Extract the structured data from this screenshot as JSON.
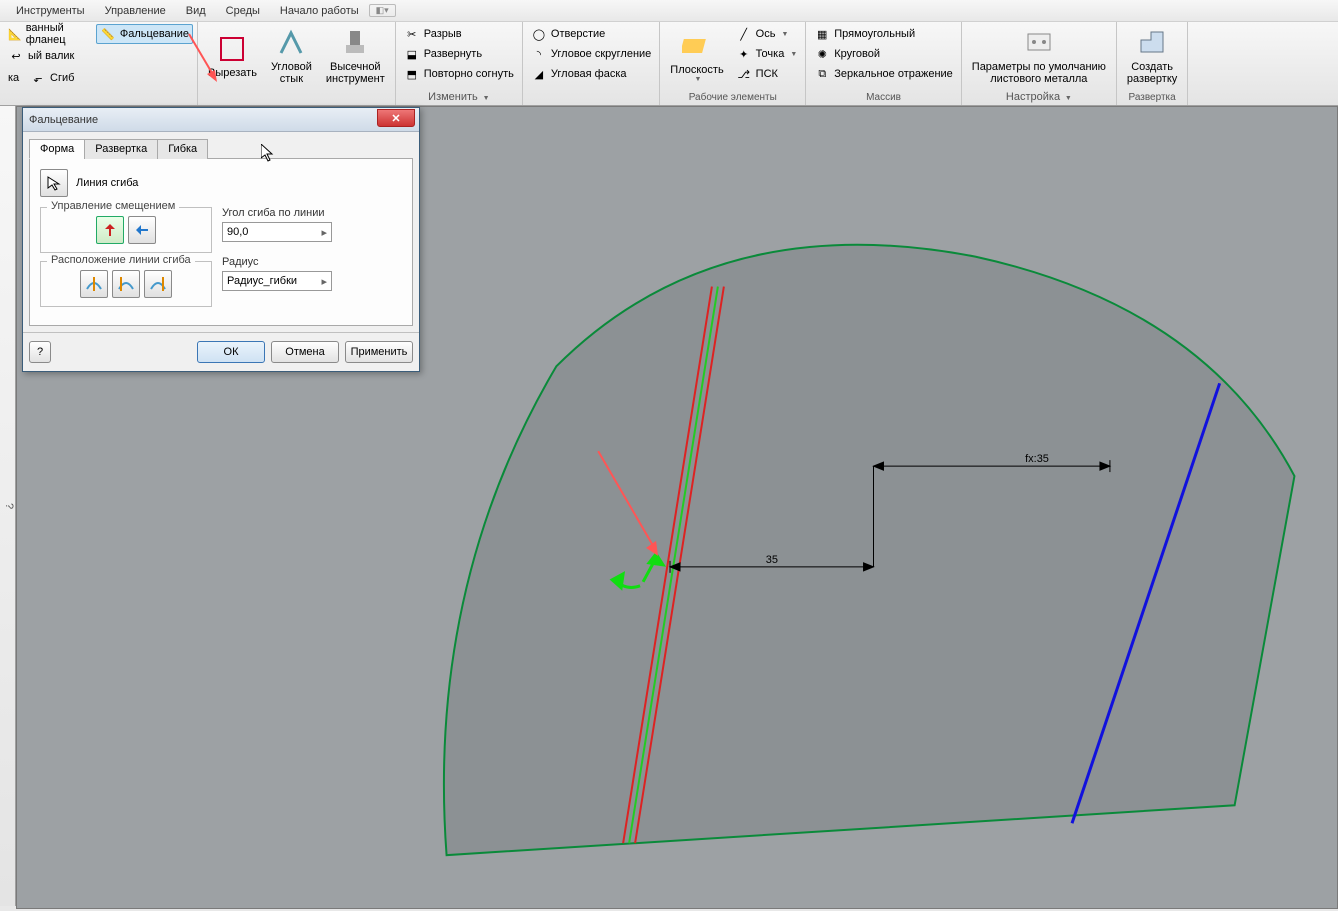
{
  "menu": {
    "items": [
      "Инструменты",
      "Управление",
      "Вид",
      "Среды",
      "Начало работы"
    ]
  },
  "ribbon": {
    "left": {
      "flange": "ванный фланец",
      "fold": "Фальцевание",
      "roll": "ый валик",
      "bend": "Сгиб",
      "ka": "ка"
    },
    "cut": {
      "label": "Вырезать"
    },
    "corner": {
      "label": "Угловой\nстык"
    },
    "punch": {
      "label": "Высечной\nинструмент"
    },
    "modify": {
      "rip": "Разрыв",
      "unfold": "Развернуть",
      "refold": "Повторно согнуть",
      "title": "Изменить"
    },
    "hole": {
      "hole": "Отверстие",
      "round": "Угловое скругление",
      "chamfer": "Угловая фаска"
    },
    "plane": {
      "label": "Плоскость",
      "axis": "Ось",
      "point": "Точка",
      "ucs": "ПСК",
      "title": "Рабочие элементы"
    },
    "pattern": {
      "rect": "Прямоугольный",
      "circ": "Круговой",
      "mirror": "Зеркальное отражение",
      "title": "Массив"
    },
    "setup": {
      "defaults": "Параметры по умолчанию\nлистового металла",
      "title": "Настройка"
    },
    "flat": {
      "label": "Создать\nразвертку",
      "title": "Развертка"
    }
  },
  "dialog": {
    "title": "Фальцевание",
    "tabs": {
      "shape": "Форма",
      "flat": "Развертка",
      "bend": "Гибка"
    },
    "bendline_label": "Линия сгиба",
    "offset_label": "Управление смещением",
    "angle_label": "Угол сгиба по линии",
    "angle_value": "90,0",
    "radius_label": "Радиус",
    "radius_value": "Радиус_гибки",
    "linepos_label": "Расположение линии сгиба",
    "ok": "ОК",
    "cancel": "Отмена",
    "apply": "Применить"
  },
  "canvas": {
    "dim1": "35",
    "dim2": "fx:35"
  }
}
